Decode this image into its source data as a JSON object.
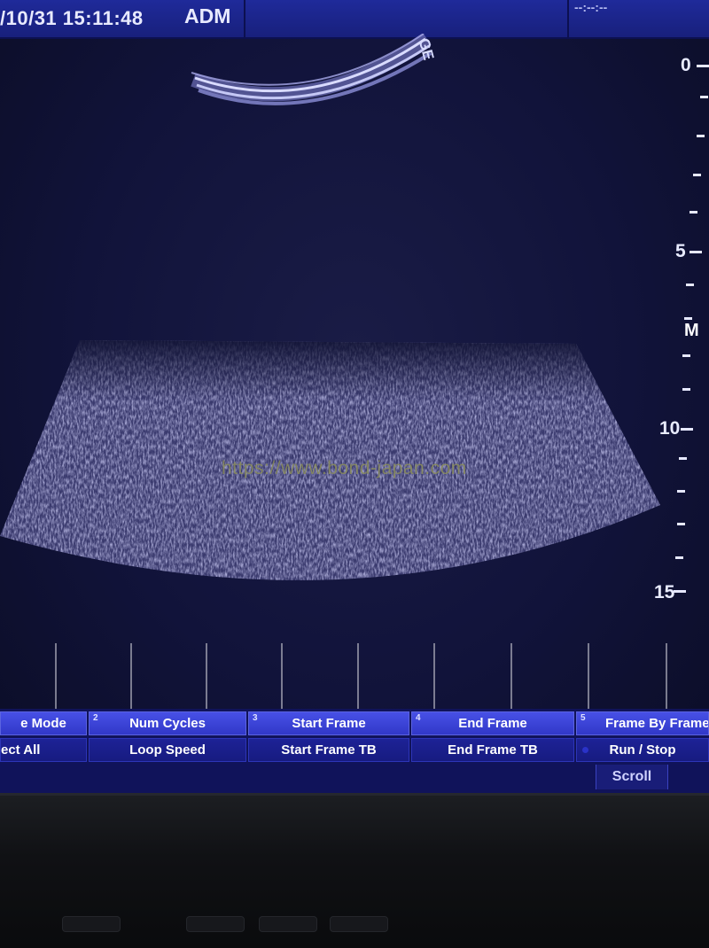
{
  "header": {
    "datetime": "/10/31 15:11:48",
    "user": "ADM",
    "right_indicator": "--:--:--"
  },
  "probe_logo": "GE",
  "watermark": "https://www.bond-japan.com",
  "depth_scale": {
    "labels": [
      "0",
      "5",
      "10",
      "15"
    ],
    "unit_marker": "M"
  },
  "softkeys": {
    "row1": [
      {
        "num": "",
        "label": "e Mode"
      },
      {
        "num": "2",
        "label": "Num Cycles"
      },
      {
        "num": "3",
        "label": "Start Frame"
      },
      {
        "num": "4",
        "label": "End Frame"
      },
      {
        "num": "5",
        "label": "Frame By Frame"
      }
    ],
    "row2": [
      {
        "label": "ect All"
      },
      {
        "label": "Loop Speed"
      },
      {
        "label": "Start Frame TB"
      },
      {
        "label": "End Frame TB"
      },
      {
        "label": "Run / Stop"
      }
    ],
    "scroll": "Scroll"
  },
  "colors": {
    "menu_active": "#4750e6",
    "menu_inactive": "#1d2296",
    "background": "#11133a"
  }
}
